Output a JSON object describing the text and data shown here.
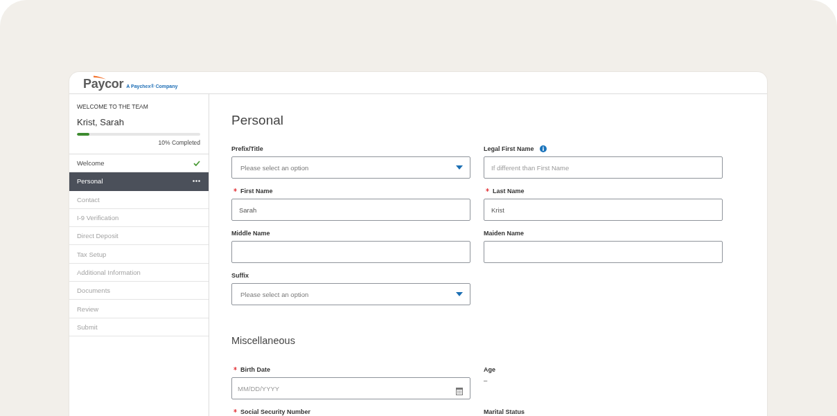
{
  "header": {
    "logo": "Paycor",
    "tagline": "A Paychex® Company"
  },
  "sidebar": {
    "eyebrow": "WELCOME TO THE TEAM",
    "name": "Krist, Sarah",
    "progress": {
      "level": 0.1,
      "label": "10% Completed"
    },
    "steps": [
      {
        "label": "Welcome",
        "selected": false,
        "completed": true,
        "disabled": false
      },
      {
        "label": "Personal",
        "selected": true,
        "completed": false,
        "disabled": false
      },
      {
        "label": "Contact",
        "selected": false,
        "completed": false,
        "disabled": true
      },
      {
        "label": "I-9 Verification",
        "selected": false,
        "completed": false,
        "disabled": true
      },
      {
        "label": "Direct Deposit",
        "selected": false,
        "completed": false,
        "disabled": true
      },
      {
        "label": "Tax Setup",
        "selected": false,
        "completed": false,
        "disabled": true
      },
      {
        "label": "Additional Information",
        "selected": false,
        "completed": false,
        "disabled": true
      },
      {
        "label": "Documents",
        "selected": false,
        "completed": false,
        "disabled": true
      },
      {
        "label": "Review",
        "selected": false,
        "completed": false,
        "disabled": true
      },
      {
        "label": "Submit",
        "selected": false,
        "completed": false,
        "disabled": true
      }
    ]
  },
  "main": {
    "sections": [
      {
        "kind": "page",
        "title": "Personal",
        "fields": [
          {
            "kind": "select",
            "label": "Prefix/Title",
            "required": false,
            "info": false,
            "placeholder": "Please select an option"
          },
          {
            "kind": "text",
            "label": "Legal First Name",
            "required": false,
            "info": true,
            "placeholder": "If different than First Name"
          },
          {
            "kind": "text",
            "label": "First Name",
            "required": true,
            "info": false,
            "value": "Sarah"
          },
          {
            "kind": "text",
            "label": "Last Name",
            "required": true,
            "info": false,
            "value": "Krist"
          },
          {
            "kind": "text",
            "label": "Middle Name",
            "required": false,
            "info": false
          },
          {
            "kind": "text",
            "label": "Maiden Name",
            "required": false,
            "info": false
          },
          {
            "kind": "select",
            "label": "Suffix",
            "required": false,
            "info": false,
            "placeholder": "Please select an option"
          }
        ]
      },
      {
        "kind": "group",
        "title": "Miscellaneous",
        "fields": [
          {
            "kind": "date",
            "label": "Birth Date",
            "required": true,
            "info": false,
            "placeholder": "MM/DD/YYYY"
          },
          {
            "kind": "readonly",
            "label": "Age",
            "required": false,
            "info": false,
            "value": "–"
          },
          {
            "kind": "label",
            "label": "Social Security Number",
            "required": true,
            "info": false
          },
          {
            "kind": "label",
            "label": "Marital Status",
            "required": false,
            "info": false
          }
        ]
      }
    ]
  }
}
